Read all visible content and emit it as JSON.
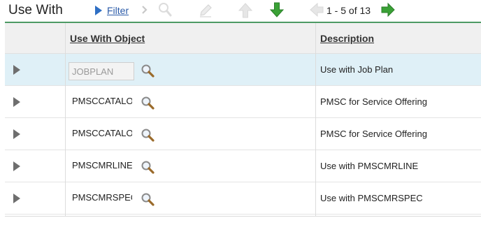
{
  "section": {
    "title": "Use With"
  },
  "toolbar": {
    "filter_label": "Filter",
    "page_info": "1 - 5 of 13",
    "icons": [
      "filter-arrow-icon",
      "chevron-right-icon",
      "search-icon",
      "pencil-icon",
      "arrow-up-icon",
      "arrow-down-icon",
      "arrow-left-icon",
      "arrow-right-icon"
    ],
    "colors": {
      "green_enabled": "#3aa136",
      "disabled_gray": "#d9d9d9",
      "link_blue": "#2a5aa8"
    }
  },
  "table": {
    "columns": {
      "object": "Use With Object",
      "description": "Description"
    },
    "rows": [
      {
        "object": "JOBPLAN",
        "description": "Use with Job Plan",
        "selected": true,
        "readonly": true
      },
      {
        "object": "PMSCCATALOG",
        "description": "PMSC for Service Offering"
      },
      {
        "object": "PMSCCATALOG",
        "description": "PMSC for Service Offering"
      },
      {
        "object": "PMSCMRLINE",
        "description": "Use with PMSCMRLINE"
      },
      {
        "object": "PMSCMRSPEC",
        "description": "Use with PMSCMRSPEC"
      }
    ],
    "colors": {
      "header_bg": "#f0f0f0",
      "selected_bg": "#dff0f7",
      "accent_line": "#4d9a64"
    }
  }
}
